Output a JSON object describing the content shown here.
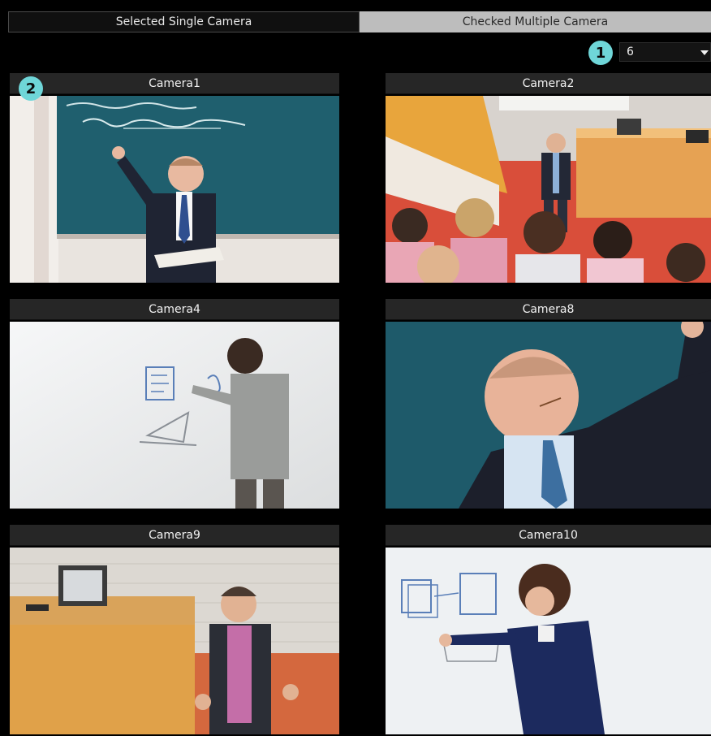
{
  "tabs": {
    "single_label": "Selected Single Camera",
    "multiple_label": "Checked Multiple Camera"
  },
  "badges": {
    "one": "1",
    "two": "2"
  },
  "layout_select": {
    "value": "6"
  },
  "cameras": [
    {
      "label": "Camera1"
    },
    {
      "label": "Camera2"
    },
    {
      "label": "Camera4"
    },
    {
      "label": "Camera8"
    },
    {
      "label": "Camera9"
    },
    {
      "label": "Camera10"
    }
  ],
  "colors": {
    "accent": "#6fd6d8",
    "chalkboard": "#1f5f6e",
    "tab_checked": "#bdbdbd"
  }
}
